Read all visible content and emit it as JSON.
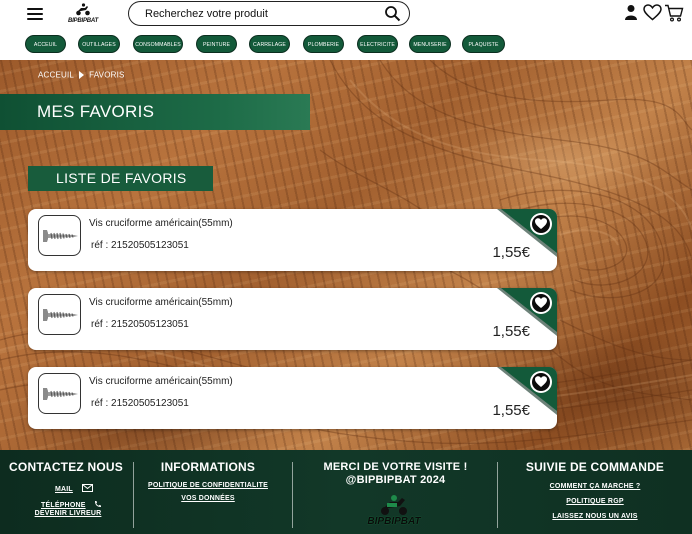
{
  "header": {
    "logo_text": "BIPBIPBAT",
    "search": {
      "placeholder": "Recherchez votre produit"
    },
    "categories": [
      "ACCEUIL",
      "OUTILLAGES",
      "CONSOMMABLES",
      "PEINTURE",
      "CARRELAGE",
      "PLOMBERIE",
      "ELECTRICITE",
      "MENUISERIE",
      "PLAQUISTE"
    ]
  },
  "breadcrumb": {
    "home": "ACCEUIL",
    "current": "FAVORIS"
  },
  "page_title": "MES FAVORIS",
  "list_title": "LISTE DE FAVORIS",
  "favorites": [
    {
      "name": "Vis cruciforme américain(55mm)",
      "ref": "réf : 21520505123051",
      "price": "1,55€"
    },
    {
      "name": "Vis cruciforme américain(55mm)",
      "ref": "réf : 21520505123051",
      "price": "1,55€"
    },
    {
      "name": "Vis cruciforme américain(55mm)",
      "ref": "réf : 21520505123051",
      "price": "1,55€"
    }
  ],
  "footer": {
    "contact": {
      "title": "CONTACTEZ NOUS",
      "mail": "MAIL",
      "phone": "TÉLÉPHONE",
      "driver": "DEVENIR LIVREUR"
    },
    "info": {
      "title": "INFORMATIONS",
      "privacy": "POLITIQUE DE CONFIDENTIALITE",
      "data": "VOS DONNÉES"
    },
    "thanks": {
      "line1": "MERCI DE VOTRE VISITE !",
      "line2": "@BIPBIPBAT 2024",
      "logo_text": "BIPBIPBAT"
    },
    "order": {
      "title": "SUIVIE DE COMMANDE",
      "how": "COMMENT ÇA MARCHE ?",
      "rgp": "POLITIQUE RGP",
      "review": "LAISSEZ NOUS UN AVIS"
    }
  },
  "colors": {
    "brand_green": "#135a3a",
    "footer_bg": "#0f3022",
    "wood": "#a9652f"
  }
}
